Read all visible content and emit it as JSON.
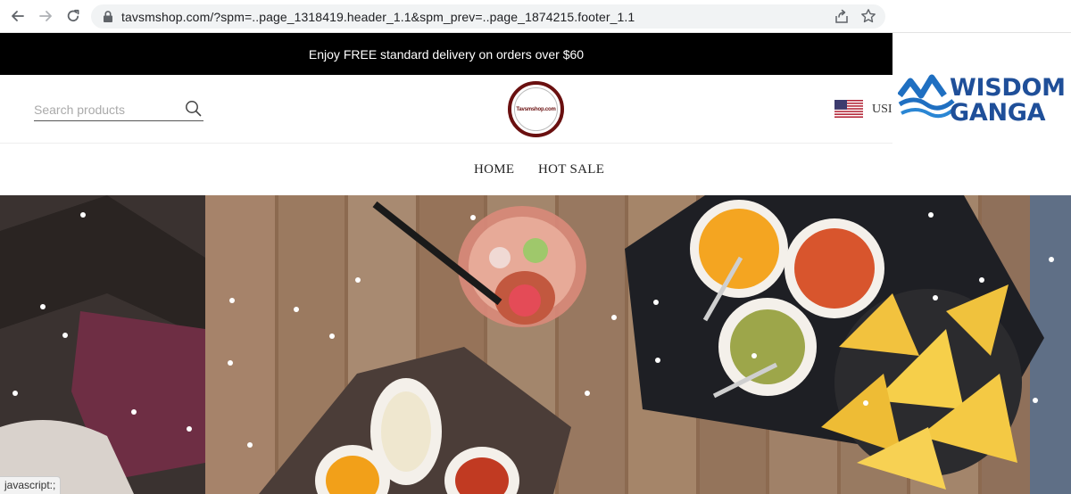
{
  "browser": {
    "url": "tavsmshop.com/?spm=..page_1318419.header_1.1&spm_prev=..page_1874215.footer_1.1",
    "icons": [
      "back-arrow-icon",
      "forward-arrow-icon",
      "reload-icon",
      "lock-icon",
      "share-icon",
      "bookmark-star-icon"
    ]
  },
  "promo": {
    "text": "Enjoy FREE standard delivery on orders over $60"
  },
  "header": {
    "search_placeholder": "Search products",
    "logo_text": "Tavsmshop.com",
    "currency": "USI"
  },
  "menu": {
    "items": [
      "HOME",
      "HOT SALE"
    ]
  },
  "watermark": {
    "line1": "WISDOM",
    "line2": "GANGA"
  },
  "status_bar": {
    "text": "javascript:;"
  },
  "colors": {
    "promo_bg": "#000000",
    "logo_ring": "#6a1010",
    "watermark_blue": "#1f4f99"
  }
}
